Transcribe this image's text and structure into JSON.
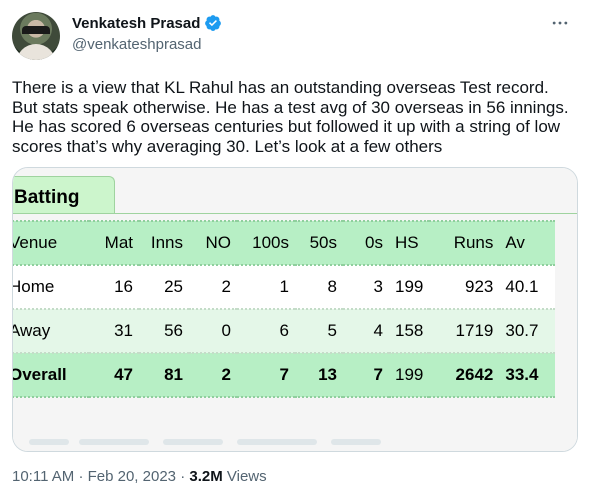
{
  "author": {
    "display_name": "Venkatesh Prasad",
    "handle": "@venkateshprasad",
    "verified": true,
    "verified_color": "#1d9bf0"
  },
  "more_icon": "ellipsis-icon",
  "tweet": {
    "text": "There is a view that KL Rahul has an outstanding overseas Test record. But stats speak otherwise. He has a test avg of 30 overseas in 56 innings. He has scored 6 overseas centuries but followed it up with a string of low scores that’s why averaging 30. Let’s look at a few others"
  },
  "media": {
    "tab_label": "Batting",
    "columns": [
      "Venue",
      "Mat",
      "Inns",
      "NO",
      "100s",
      "50s",
      "0s",
      "HS",
      "Runs",
      "Av"
    ],
    "rows": [
      {
        "venue": "Home",
        "mat": "16",
        "inns": "25",
        "no": "2",
        "hundreds": "1",
        "fifties": "8",
        "ducks": "3",
        "hs": "199",
        "runs": "923",
        "avg": "40.1"
      },
      {
        "venue": "Away",
        "mat": "31",
        "inns": "56",
        "no": "0",
        "hundreds": "6",
        "fifties": "5",
        "ducks": "4",
        "hs": "158",
        "runs": "1719",
        "avg": "30.7"
      },
      {
        "venue": "Overall",
        "mat": "47",
        "inns": "81",
        "no": "2",
        "hundreds": "7",
        "fifties": "13",
        "ducks": "7",
        "hs": "199",
        "runs": "2642",
        "avg": "33.4"
      }
    ],
    "colors": {
      "header_green": "#b7efc5",
      "away_green": "#e4f7e8",
      "tab_green": "#ccf5cc"
    }
  },
  "meta": {
    "time": "10:11 AM",
    "separator": "·",
    "date": "Feb 20, 2023",
    "views_count": "3.2M",
    "views_label": "Views"
  }
}
